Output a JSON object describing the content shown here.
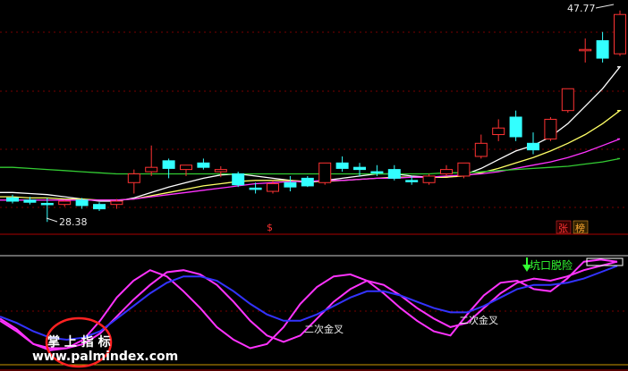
{
  "price_panel": {
    "high_label": "47.77",
    "low_label": "28.38",
    "signal_marker": "$",
    "badge_zhang": "张",
    "badge_bang": "榜"
  },
  "indicator_panel": {
    "cross_label_1": "二次金叉",
    "cross_label_2": "二次金叉",
    "breakout_label": "坑口脱险"
  },
  "watermark": {
    "cn": "掌 上 指 标",
    "url": "www.palmindex.com"
  },
  "colors": {
    "background": "#000000",
    "candle_up": "#ff3333",
    "candle_down": "#33ffff",
    "ma_white": "#ffffff",
    "ma_yellow": "#ffff66",
    "ma_magenta": "#ff33ff",
    "ma_green": "#33cc33",
    "osc_fast": "#ff33ff",
    "osc_slow": "#3333ff",
    "circle": "#ff2222"
  },
  "chart_data": [
    {
      "type": "candlestick",
      "description": "price candles with moving averages",
      "candles": [
        {
          "o": 30.6,
          "h": 30.9,
          "l": 30.1,
          "c": 30.3
        },
        {
          "o": 30.4,
          "h": 30.7,
          "l": 30.0,
          "c": 30.2
        },
        {
          "o": 30.1,
          "h": 30.6,
          "l": 28.4,
          "c": 30.0
        },
        {
          "o": 30.0,
          "h": 30.4,
          "l": 29.8,
          "c": 30.3
        },
        {
          "o": 30.4,
          "h": 30.6,
          "l": 29.6,
          "c": 29.9
        },
        {
          "o": 30.0,
          "h": 30.2,
          "l": 29.4,
          "c": 29.6
        },
        {
          "o": 30.0,
          "h": 30.5,
          "l": 29.6,
          "c": 30.3
        },
        {
          "o": 32.0,
          "h": 33.2,
          "l": 31.0,
          "c": 32.8
        },
        {
          "o": 33.0,
          "h": 35.4,
          "l": 32.6,
          "c": 33.4
        },
        {
          "o": 34.0,
          "h": 34.2,
          "l": 32.4,
          "c": 33.3
        },
        {
          "o": 33.2,
          "h": 33.6,
          "l": 32.6,
          "c": 33.6
        },
        {
          "o": 33.8,
          "h": 34.2,
          "l": 33.2,
          "c": 33.4
        },
        {
          "o": 33.0,
          "h": 33.5,
          "l": 32.5,
          "c": 33.2
        },
        {
          "o": 32.8,
          "h": 33.0,
          "l": 31.6,
          "c": 31.8
        },
        {
          "o": 31.5,
          "h": 32.0,
          "l": 31.0,
          "c": 31.4
        },
        {
          "o": 31.2,
          "h": 32.2,
          "l": 31.0,
          "c": 31.9
        },
        {
          "o": 32.0,
          "h": 32.6,
          "l": 31.2,
          "c": 31.6
        },
        {
          "o": 32.4,
          "h": 32.6,
          "l": 31.6,
          "c": 31.7
        },
        {
          "o": 32.0,
          "h": 33.4,
          "l": 31.8,
          "c": 33.8
        },
        {
          "o": 33.8,
          "h": 34.4,
          "l": 33.0,
          "c": 33.3
        },
        {
          "o": 33.4,
          "h": 33.8,
          "l": 32.6,
          "c": 33.2
        },
        {
          "o": 33.0,
          "h": 33.6,
          "l": 32.6,
          "c": 32.9
        },
        {
          "o": 33.2,
          "h": 33.6,
          "l": 32.2,
          "c": 32.4
        },
        {
          "o": 32.2,
          "h": 32.6,
          "l": 31.8,
          "c": 32.1
        },
        {
          "o": 32.0,
          "h": 32.8,
          "l": 31.8,
          "c": 32.6
        },
        {
          "o": 32.8,
          "h": 33.6,
          "l": 32.6,
          "c": 33.2
        },
        {
          "o": 32.6,
          "h": 33.2,
          "l": 32.4,
          "c": 33.8
        },
        {
          "o": 34.4,
          "h": 36.4,
          "l": 34.2,
          "c": 35.6
        },
        {
          "o": 36.4,
          "h": 37.8,
          "l": 35.8,
          "c": 37.0
        },
        {
          "o": 38.0,
          "h": 38.6,
          "l": 35.8,
          "c": 36.2
        },
        {
          "o": 35.6,
          "h": 36.6,
          "l": 34.6,
          "c": 35.0
        },
        {
          "o": 36.0,
          "h": 38.0,
          "l": 35.8,
          "c": 37.8
        },
        {
          "o": 38.6,
          "h": 40.6,
          "l": 38.4,
          "c": 40.6
        },
        {
          "o": 44.2,
          "h": 45.2,
          "l": 43.0,
          "c": 44.2
        },
        {
          "o": 45.0,
          "h": 45.8,
          "l": 43.0,
          "c": 43.4
        },
        {
          "o": 43.8,
          "h": 47.77,
          "l": 43.6,
          "c": 47.4
        }
      ],
      "moving_averages": [
        {
          "color": "ma_white",
          "values": [
            31.1,
            31.0,
            30.9,
            30.7,
            30.5,
            30.3,
            30.3,
            30.6,
            31.1,
            31.6,
            32.0,
            32.4,
            32.7,
            32.8,
            32.6,
            32.4,
            32.2,
            32.0,
            32.2,
            32.4,
            32.6,
            32.8,
            32.8,
            32.6,
            32.5,
            32.5,
            32.7,
            33.3,
            34.1,
            34.9,
            35.4,
            36.2,
            37.4,
            39.0,
            40.6,
            42.6
          ]
        },
        {
          "color": "ma_yellow",
          "values": [
            30.7,
            30.6,
            30.6,
            30.5,
            30.5,
            30.4,
            30.4,
            30.5,
            30.8,
            31.1,
            31.4,
            31.7,
            31.9,
            32.1,
            32.2,
            32.2,
            32.2,
            32.1,
            32.1,
            32.2,
            32.3,
            32.4,
            32.5,
            32.5,
            32.5,
            32.5,
            32.6,
            32.9,
            33.3,
            33.8,
            34.3,
            34.9,
            35.6,
            36.4,
            37.4,
            38.6
          ]
        },
        {
          "color": "ma_magenta",
          "values": [
            30.4,
            30.4,
            30.4,
            30.4,
            30.4,
            30.4,
            30.4,
            30.5,
            30.7,
            30.9,
            31.1,
            31.3,
            31.5,
            31.7,
            31.9,
            32.0,
            32.1,
            32.1,
            32.2,
            32.2,
            32.3,
            32.4,
            32.4,
            32.5,
            32.5,
            32.6,
            32.7,
            32.8,
            33.0,
            33.3,
            33.6,
            33.9,
            34.3,
            34.8,
            35.4,
            36.0
          ]
        },
        {
          "color": "ma_green",
          "values": [
            33.4,
            33.3,
            33.2,
            33.1,
            33.0,
            32.9,
            32.8,
            32.8,
            32.8,
            32.8,
            32.8,
            32.8,
            32.8,
            32.8,
            32.8,
            32.8,
            32.8,
            32.8,
            32.8,
            32.8,
            32.8,
            32.8,
            32.8,
            32.8,
            32.8,
            32.9,
            32.9,
            33.0,
            33.1,
            33.2,
            33.3,
            33.4,
            33.5,
            33.7,
            33.9,
            34.2
          ]
        }
      ],
      "ylim": [
        27.6,
        48.4
      ]
    },
    {
      "type": "line",
      "description": "oscillator panel",
      "ylim": [
        0,
        100
      ],
      "series": [
        {
          "color": "osc_fast",
          "values": [
            42,
            32,
            18,
            12,
            14,
            22,
            40,
            62,
            78,
            88,
            82,
            68,
            52,
            34,
            22,
            14,
            18,
            34,
            56,
            72,
            82,
            84,
            78,
            66,
            52,
            40,
            30,
            26,
            46,
            64,
            76,
            78,
            70,
            68,
            80,
            96,
            98,
            96
          ]
        },
        {
          "color": "osc_fast",
          "values": [
            40,
            30,
            18,
            14,
            14,
            18,
            28,
            44,
            60,
            74,
            86,
            88,
            84,
            74,
            58,
            40,
            26,
            20,
            26,
            42,
            58,
            70,
            78,
            74,
            64,
            52,
            42,
            34,
            38,
            52,
            66,
            76,
            80,
            78,
            82,
            88,
            92,
            96
          ]
        },
        {
          "color": "osc_slow",
          "values": [
            44,
            38,
            30,
            24,
            22,
            24,
            30,
            42,
            54,
            66,
            76,
            82,
            82,
            78,
            68,
            56,
            46,
            40,
            40,
            46,
            54,
            62,
            68,
            68,
            64,
            58,
            52,
            48,
            48,
            54,
            62,
            70,
            74,
            74,
            76,
            80,
            86,
            92
          ]
        }
      ]
    }
  ]
}
